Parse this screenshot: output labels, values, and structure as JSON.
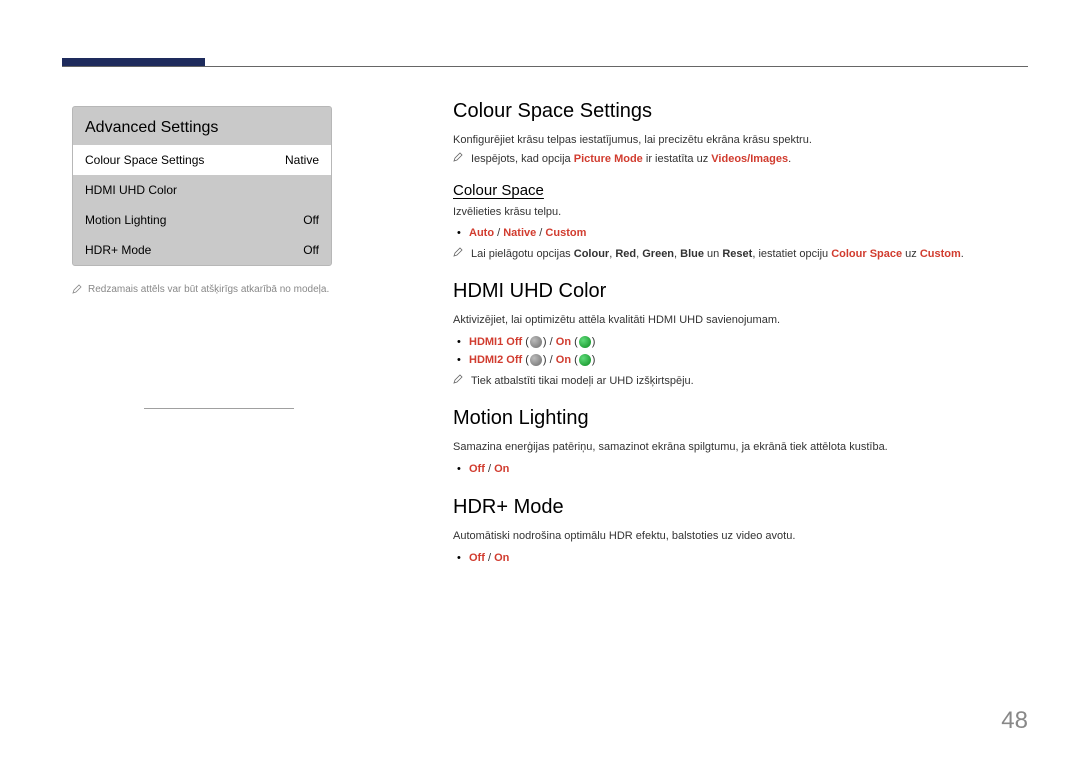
{
  "pageNumber": "48",
  "leftPanel": {
    "title": "Advanced Settings",
    "rows": [
      {
        "label": "Colour Space Settings",
        "value": "Native",
        "selected": true
      },
      {
        "label": "HDMI UHD Color",
        "value": "",
        "selected": false
      },
      {
        "label": "Motion Lighting",
        "value": "Off",
        "selected": false
      },
      {
        "label": "HDR+ Mode",
        "value": "Off",
        "selected": false
      }
    ],
    "footnote": "Redzamais attēls var būt atšķirīgs atkarībā no modeļa."
  },
  "css": {
    "heading": "Colour Space Settings",
    "desc": "Konfigurējiet krāsu telpas iestatījumus, lai precizētu ekrāna krāsu spektru.",
    "note_parts": {
      "p1": "Iespējots, kad opcija ",
      "p2": "Picture Mode",
      "p3": " ir iestatīta uz ",
      "p4": "Videos/Images",
      "p5": "."
    },
    "sub": {
      "heading": "Colour Space",
      "desc": "Izvēlieties krāsu telpu.",
      "opts": {
        "o1": "Auto",
        "o2": "Native",
        "o3": "Custom",
        "sep": " / "
      },
      "note_parts": {
        "p1": "Lai pielāgotu opcijas ",
        "p2": "Colour",
        "c2": ", ",
        "p3": "Red",
        "c3": ", ",
        "p4": "Green",
        "c4": ", ",
        "p5": "Blue",
        "c5": " un ",
        "p6": "Reset",
        "c6": ", iestatiet opciju ",
        "p7": "Colour Space",
        "c7": " uz ",
        "p8": "Custom",
        "c8": "."
      }
    }
  },
  "hdmi": {
    "heading": "HDMI UHD Color",
    "desc": "Aktivizējiet, lai optimizētu attēla kvalitāti HDMI UHD savienojumam.",
    "row": {
      "h1": "HDMI1",
      "h2": "HDMI2",
      "off": "Off",
      "on": "On",
      "lp": " (",
      "rp": ")",
      "sep": " / ",
      "sp": " "
    },
    "note": "Tiek atbalstīti tikai modeļi ar UHD izšķirtspēju."
  },
  "motion": {
    "heading": "Motion Lighting",
    "desc": "Samazina enerģijas patēriņu, samazinot ekrāna spilgtumu, ja ekrānā tiek attēlota kustība.",
    "opts": {
      "off": "Off",
      "on": "On",
      "sep": " / "
    }
  },
  "hdr": {
    "heading": "HDR+ Mode",
    "desc": "Automātiski nodrošina optimālu HDR efektu, balstoties uz video avotu.",
    "opts": {
      "off": "Off",
      "on": "On",
      "sep": " / "
    }
  }
}
